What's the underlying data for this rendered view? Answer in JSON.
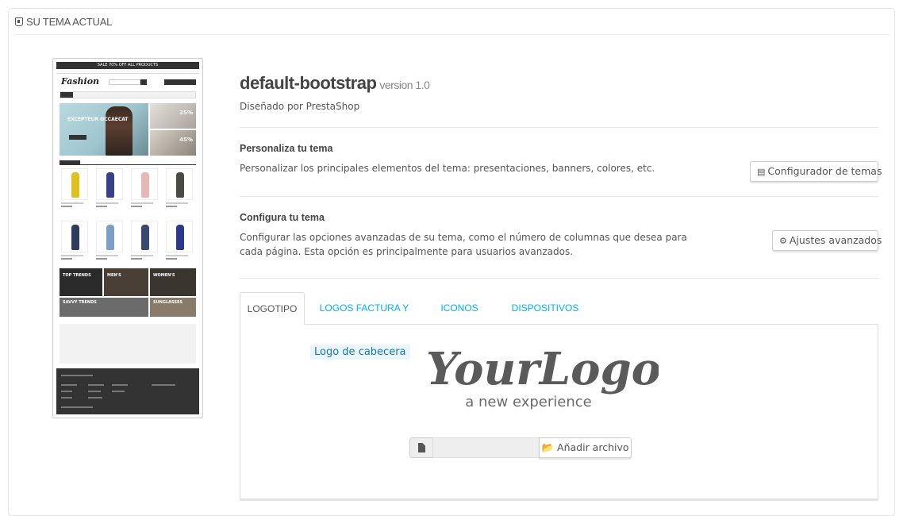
{
  "panel": {
    "heading": "SU TEMA ACTUAL"
  },
  "preview": {
    "top_banner": "SALE 70% OFF ALL PRODUCTS",
    "logo_text": "Fashion",
    "hero_text": "EXCEPTEUR OCCAECAT",
    "side_badge_1": "25%",
    "side_badge_2": "45%",
    "banners": [
      "TOP TRENDS",
      "MEN'S",
      "WOMEN'S",
      "SAVVY TRENDS",
      "SUNGLASSES"
    ]
  },
  "theme": {
    "name": "default-bootstrap",
    "version": "version 1.0",
    "designed_by": "Diseñado por PrestaShop"
  },
  "customize": {
    "title": "Personaliza tu tema",
    "description": "Personalizar los principales elementos del tema: presentaciones, banners, colores, etc.",
    "button_label": "Configurador de temas",
    "button_icon": "list-icon"
  },
  "configure": {
    "title": "Configura tu tema",
    "description_line1": "Configurar las opciones avanzadas de su tema, como el número de columnas que desea para",
    "description_line2": "cada página. Esta opción es principalmente para usuarios avanzados.",
    "button_label": "Ajustes avanzados",
    "button_icon": "cog-icon"
  },
  "tabs": [
    {
      "label": "LOGOTIPO",
      "active": true
    },
    {
      "label": "LOGOS FACTURA Y EMAIL",
      "active": false
    },
    {
      "label": "ICONOS",
      "active": false
    },
    {
      "label": "DISPOSITIVOS MÓVILES",
      "active": false
    }
  ],
  "logo_tab": {
    "label": "Logo de cabecera",
    "logo_main": "YourLogo",
    "logo_sub": "a new experience",
    "file_input_value": "",
    "add_file_label": "Añadir archivo"
  },
  "colors": {
    "accent": "#00aff0",
    "label_bg": "#eaf4fb",
    "label_text": "#1b7aa8"
  }
}
